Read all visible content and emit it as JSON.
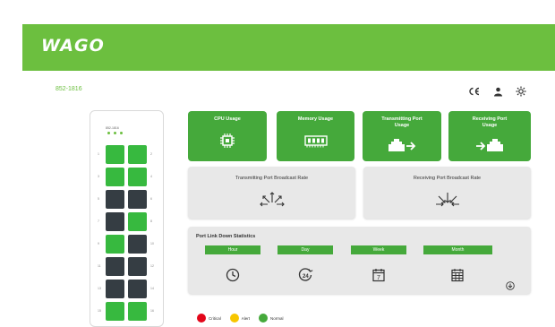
{
  "header": {
    "brand": "WAGO",
    "model": "852-1816"
  },
  "header_icons": [
    "ce-mark-icon",
    "user-icon",
    "settings-icon"
  ],
  "panel": {
    "label": "852-1816",
    "ports": [
      {
        "num": "1",
        "state": "up"
      },
      {
        "num": "2",
        "state": "up"
      },
      {
        "num": "3",
        "state": "up"
      },
      {
        "num": "4",
        "state": "up"
      },
      {
        "num": "5",
        "state": "down"
      },
      {
        "num": "6",
        "state": "down"
      },
      {
        "num": "7",
        "state": "down"
      },
      {
        "num": "8",
        "state": "up"
      },
      {
        "num": "9",
        "state": "up"
      },
      {
        "num": "10",
        "state": "down"
      },
      {
        "num": "11",
        "state": "down"
      },
      {
        "num": "12",
        "state": "down"
      },
      {
        "num": "13",
        "state": "down"
      },
      {
        "num": "14",
        "state": "down"
      },
      {
        "num": "15",
        "state": "up"
      },
      {
        "num": "16",
        "state": "up"
      }
    ]
  },
  "tiles": {
    "cpu": "CPU Usage",
    "memory": "Memory Usage",
    "tx_port": "Transmitting Port Usage",
    "rx_port": "Receiving Port Usage"
  },
  "broadcast": {
    "tx": "Transmitting Port Broadcast Rate",
    "rx": "Receiving Port Broadcast Rate"
  },
  "link_down": {
    "title": "Port Link Down Statistics",
    "periods": [
      "Hour",
      "Day",
      "Week",
      "Month"
    ],
    "day_icon_text": "24",
    "week_icon_text": "7"
  },
  "legend": {
    "critical": "Critical",
    "alert": "Alert",
    "normal": "Normal"
  },
  "colors": {
    "brand_green": "#6cbf3f",
    "tile_green": "#45a93b",
    "port_up": "#37b93f",
    "port_down": "#353d43",
    "critical": "#e3061a",
    "alert": "#f7c600",
    "normal": "#45a93b"
  }
}
